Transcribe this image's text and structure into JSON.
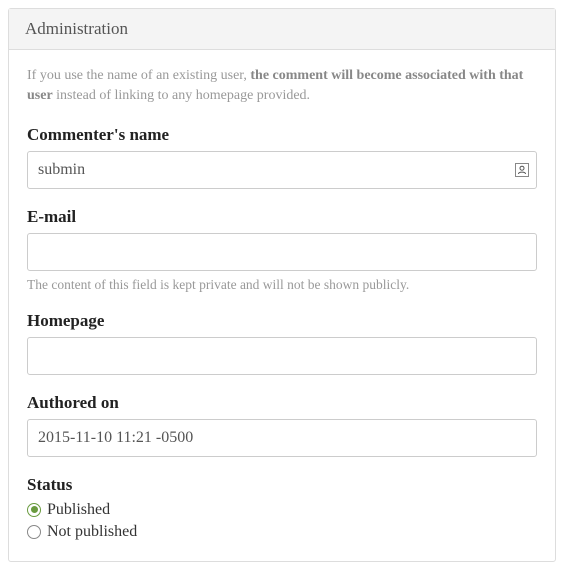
{
  "panel": {
    "title": "Administration"
  },
  "help": {
    "pre": "If you use the name of an existing user, ",
    "bold": "the comment will become associated with that user",
    "post": " instead of linking to any homepage provided."
  },
  "fields": {
    "name": {
      "label": "Commenter's name",
      "value": "submin"
    },
    "email": {
      "label": "E-mail",
      "value": "",
      "description": "The content of this field is kept private and will not be shown publicly."
    },
    "homepage": {
      "label": "Homepage",
      "value": ""
    },
    "authored": {
      "label": "Authored on",
      "value": "2015-11-10 11:21 -0500"
    },
    "status": {
      "label": "Status",
      "options": {
        "published": "Published",
        "not_published": "Not published"
      },
      "selected": "published"
    }
  },
  "icons": {
    "contact_glyph": "▼"
  }
}
